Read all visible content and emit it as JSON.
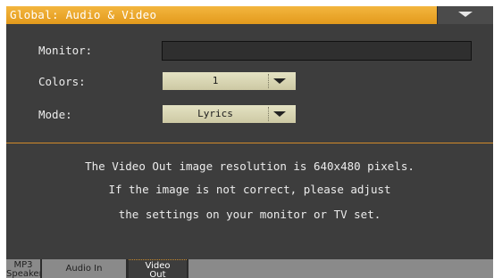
{
  "window": {
    "title": "Global: Audio & Video"
  },
  "page_menu": {
    "icon": "chevron-down-icon"
  },
  "form": {
    "monitor_label": "Monitor:",
    "monitor_value": "",
    "colors_label": "Colors:",
    "colors_value": "1",
    "mode_label": "Mode:",
    "mode_value": "Lyrics"
  },
  "message": {
    "line1": "The Video Out image resolution is 640x480 pixels.",
    "line2": "If the image is not correct, please adjust",
    "line3": "the settings on your monitor or TV set."
  },
  "tabs": [
    {
      "line1": "MP3",
      "line2": "Speaker"
    },
    {
      "line1": "Audio In",
      "line2": ""
    },
    {
      "line1": "Video",
      "line2": "Out"
    }
  ],
  "colors": {
    "title_bar": "#e9a42a",
    "background": "#3d3d3d",
    "divider": "#d28a2a",
    "select_fill": "#dad7b6"
  }
}
